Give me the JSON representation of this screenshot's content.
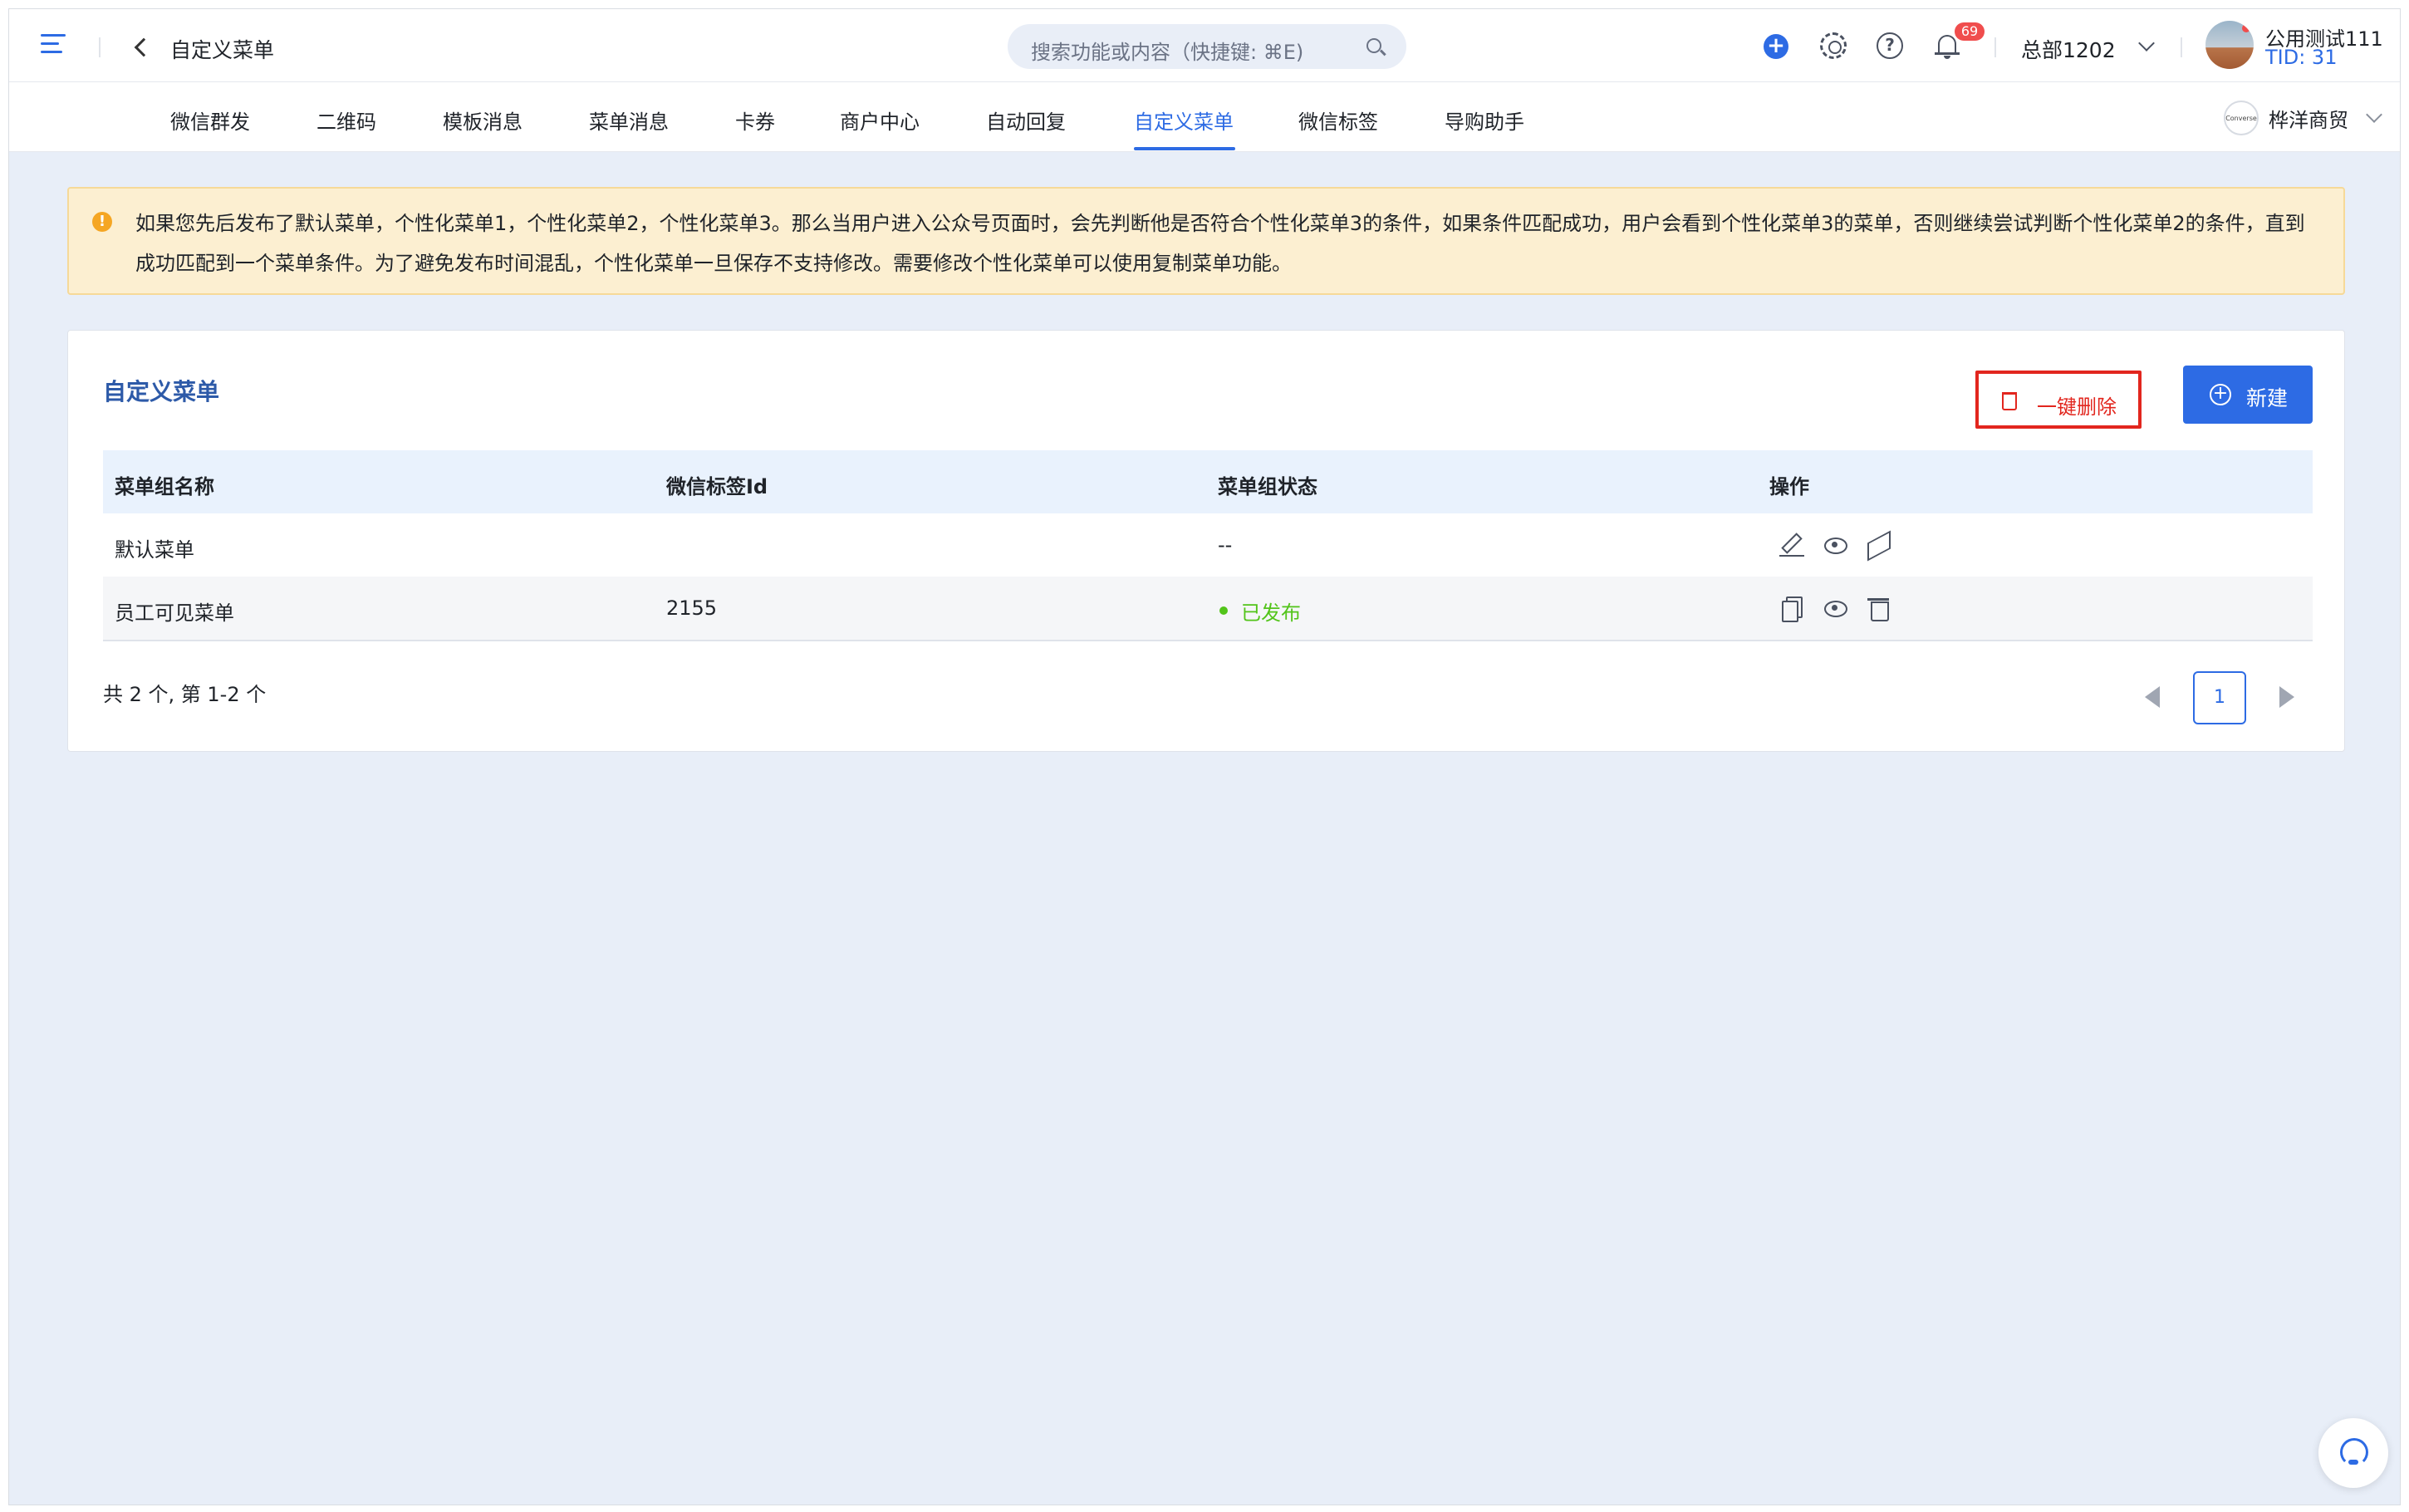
{
  "header": {
    "page_title": "自定义菜单",
    "search_placeholder": "搜索功能或内容（快捷键: ⌘E)",
    "notification_count": "69",
    "department": "总部1202",
    "user_name": "公用测试111",
    "user_tid": "TID: 31"
  },
  "tabs": [
    {
      "label": "微信群发",
      "active": false
    },
    {
      "label": "二维码",
      "active": false
    },
    {
      "label": "模板消息",
      "active": false
    },
    {
      "label": "菜单消息",
      "active": false
    },
    {
      "label": "卡券",
      "active": false
    },
    {
      "label": "商户中心",
      "active": false
    },
    {
      "label": "自动回复",
      "active": false
    },
    {
      "label": "自定义菜单",
      "active": true
    },
    {
      "label": "微信标签",
      "active": false
    },
    {
      "label": "导购助手",
      "active": false
    }
  ],
  "shop": {
    "logo_text": "Converse",
    "name": "桦洋商贸"
  },
  "notice": {
    "text": "如果您先后发布了默认菜单，个性化菜单1，个性化菜单2，个性化菜单3。那么当用户进入公众号页面时，会先判断他是否符合个性化菜单3的条件，如果条件匹配成功，用户会看到个性化菜单3的菜单，否则继续尝试判断个性化菜单2的条件，直到成功匹配到一个菜单条件。为了避免发布时间混乱，个性化菜单一旦保存不支持修改。需要修改个性化菜单可以使用复制菜单功能。"
  },
  "card": {
    "title": "自定义菜单",
    "delete_all_label": "一键删除",
    "new_label": "新建"
  },
  "table": {
    "columns": [
      "菜单组名称",
      "微信标签Id",
      "菜单组状态",
      "操作"
    ],
    "rows": [
      {
        "name": "默认菜单",
        "tag_id": "",
        "status": "--",
        "actions": [
          "edit-icon",
          "eye-icon",
          "send-icon"
        ]
      },
      {
        "name": "员工可见菜单",
        "tag_id": "2155",
        "status": "已发布",
        "actions": [
          "copy-icon",
          "eye-icon",
          "trash-icon"
        ]
      }
    ]
  },
  "pagination": {
    "summary": "共 2 个, 第 1-2 个",
    "current_page": "1"
  },
  "colors": {
    "primary": "#2d6be4",
    "danger": "#e2261e",
    "success": "#52c41a",
    "notice_bg": "#fcefd1"
  }
}
